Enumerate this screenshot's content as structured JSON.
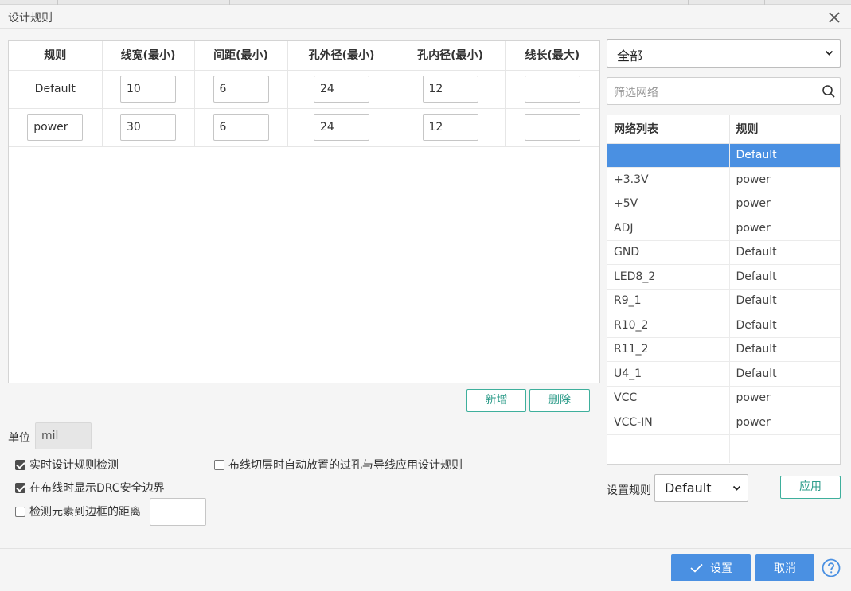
{
  "dialog": {
    "title": "设计规则"
  },
  "rules_table": {
    "headers": [
      "规则",
      "线宽(最小)",
      "间距(最小)",
      "孔外径(最小)",
      "孔内径(最小)",
      "线长(最大)"
    ],
    "rows": [
      {
        "name": "Default",
        "track": "10",
        "clearance": "6",
        "via_diameter": "24",
        "via_drill": "12",
        "track_length": ""
      },
      {
        "name": "power",
        "track": "30",
        "clearance": "6",
        "via_diameter": "24",
        "via_drill": "12",
        "track_length": ""
      }
    ]
  },
  "buttons": {
    "add": "新增",
    "delete": "删除",
    "apply": "应用",
    "ok": "设置",
    "cancel": "取消"
  },
  "unit": {
    "label": "单位",
    "value": "mil"
  },
  "options": {
    "realtime_drc": {
      "label": "实时设计规则检测",
      "checked": true
    },
    "show_drc_boundary": {
      "label": "在布线时显示DRC安全边界",
      "checked": true
    },
    "check_board_distance": {
      "label": "检测元素到边框的距离",
      "checked": false
    },
    "auto_via_rule": {
      "label": "布线切层时自动放置的过孔与导线应用设计规则",
      "checked": false
    }
  },
  "net_filter": {
    "scope": "全部",
    "placeholder": "筛选网络"
  },
  "nets_table": {
    "headers": [
      "网络列表",
      "规则"
    ],
    "rows": [
      {
        "net": "",
        "rule": "Default",
        "selected": true
      },
      {
        "net": "+3.3V",
        "rule": "power"
      },
      {
        "net": "+5V",
        "rule": "power"
      },
      {
        "net": "ADJ",
        "rule": "power"
      },
      {
        "net": "GND",
        "rule": "Default"
      },
      {
        "net": "LED8_2",
        "rule": "Default"
      },
      {
        "net": "R9_1",
        "rule": "Default"
      },
      {
        "net": "R10_2",
        "rule": "Default"
      },
      {
        "net": "R11_2",
        "rule": "Default"
      },
      {
        "net": "U4_1",
        "rule": "Default"
      },
      {
        "net": "VCC",
        "rule": "power"
      },
      {
        "net": "VCC-IN",
        "rule": "power"
      }
    ]
  },
  "set_rule": {
    "label": "设置规则",
    "value": "Default"
  },
  "colors": {
    "primary": "#4a90e2",
    "accent": "#3eaf9c",
    "selected_row": "#4a90e2"
  }
}
